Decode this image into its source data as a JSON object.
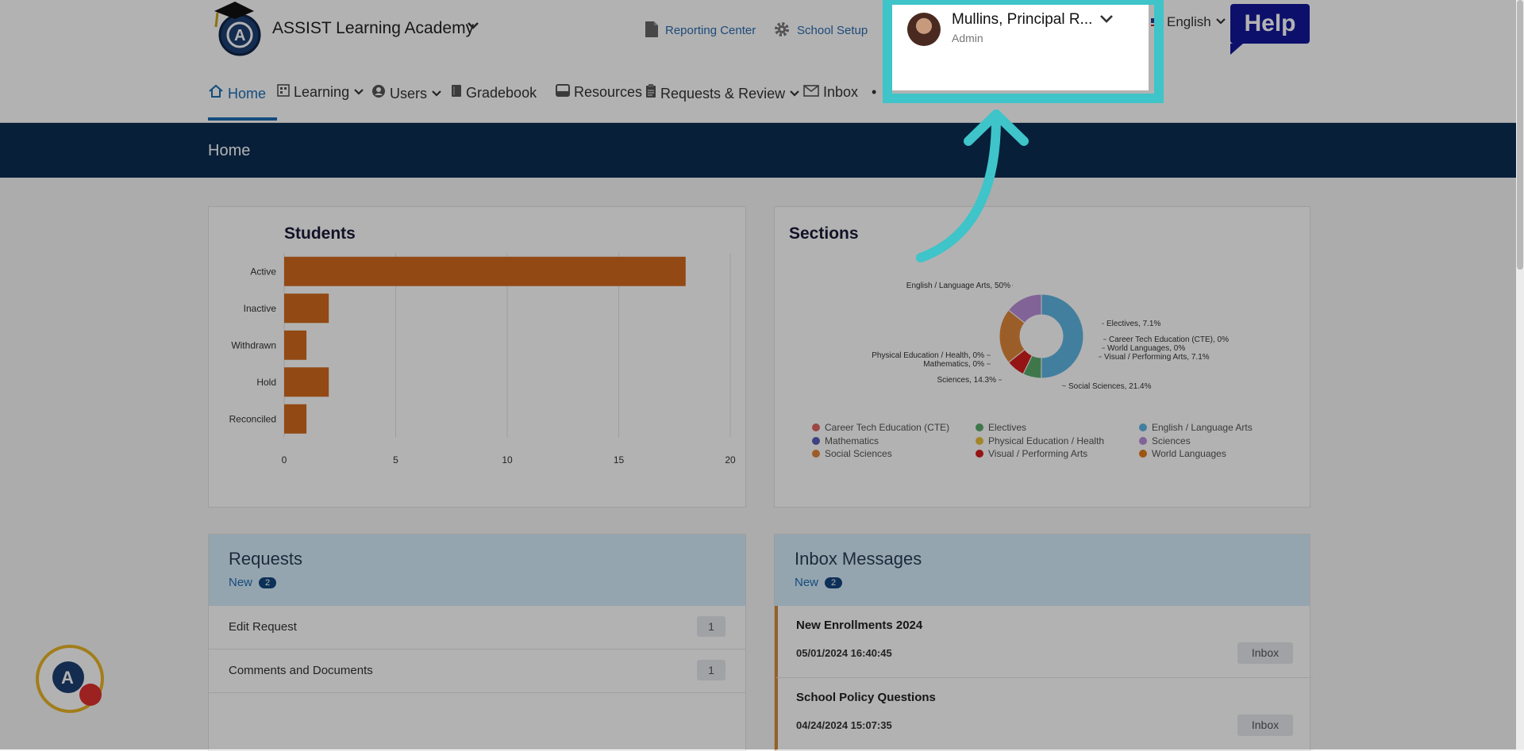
{
  "header": {
    "school_name": "ASSIST Learning Academy",
    "links": {
      "reporting": "Reporting Center",
      "setup": "School Setup"
    },
    "user": {
      "name": "Mullins, Principal R...",
      "role": "Admin"
    },
    "language": "English",
    "help_label": "Help"
  },
  "nav": {
    "home": "Home",
    "learning": "Learning",
    "users": "Users",
    "gradebook": "Gradebook",
    "resources": "Resources",
    "requests": "Requests & Review",
    "inbox": "Inbox"
  },
  "page": {
    "title": "Home"
  },
  "students_card": {
    "title": "Students"
  },
  "sections_card": {
    "title": "Sections"
  },
  "chart_data": [
    {
      "type": "bar",
      "title": "Students",
      "orientation": "horizontal",
      "categories": [
        "Active",
        "Inactive",
        "Withdrawn",
        "Hold",
        "Reconciled"
      ],
      "values": [
        18,
        2,
        1,
        2,
        1
      ],
      "xlim": [
        0,
        20
      ],
      "xticks": [
        0,
        5,
        10,
        15,
        20
      ],
      "color": "#d2691e",
      "grid": true
    },
    {
      "type": "pie",
      "title": "Sections",
      "donut": true,
      "categories": [
        "Career Tech Education (CTE)",
        "Electives",
        "English / Language Arts",
        "Mathematics",
        "Physical Education / Health",
        "Sciences",
        "Social Sciences",
        "Visual / Performing Arts",
        "World Languages"
      ],
      "values": [
        0,
        7.1,
        50,
        0,
        0,
        14.3,
        21.4,
        7.1,
        0
      ],
      "slice_labels": [
        "Career Tech Education (CTE), 0%",
        "Electives, 7.1%",
        "English / Language Arts, 50%",
        "Mathematics, 0%",
        "Physical Education / Health, 0%",
        "Sciences, 14.3%",
        "Social Sciences, 21.4%",
        "Visual / Performing Arts, 7.1%",
        "World Languages, 0%"
      ],
      "colors": [
        "#e06666",
        "#5bab6c",
        "#5fb6e3",
        "#5a5fb8",
        "#e8c23c",
        "#b98fd8",
        "#e0873a",
        "#d61f1f",
        "#e07a1a"
      ],
      "legend": "bottom"
    }
  ],
  "requests_panel": {
    "title": "Requests",
    "new_label": "New",
    "new_count": "2",
    "rows": [
      {
        "label": "Edit Request",
        "count": "1"
      },
      {
        "label": "Comments and Documents",
        "count": "1"
      }
    ]
  },
  "inbox_panel": {
    "title": "Inbox Messages",
    "new_label": "New",
    "new_count": "2",
    "messages": [
      {
        "title": "New Enrollments 2024",
        "date": "05/01/2024 16:40:45",
        "button": "Inbox"
      },
      {
        "title": "School Policy Questions",
        "date": "04/24/2024 15:07:35",
        "button": "Inbox"
      }
    ]
  },
  "colors": {
    "highlight": "#3ec4c9",
    "nav_active": "#1e6eb5",
    "banner": "#0b2d52",
    "help": "#13179a"
  }
}
